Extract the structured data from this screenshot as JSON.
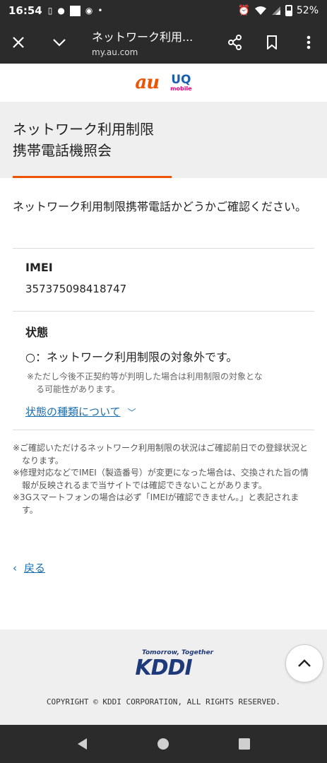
{
  "status_bar": {
    "time": "16:54",
    "battery": "52%",
    "icons": [
      "sim-icon",
      "line-icon",
      "image-icon",
      "chrome-icon",
      "dot-icon",
      "alarm-icon",
      "wifi-icon",
      "signal-icon",
      "battery-icon"
    ]
  },
  "browser": {
    "title": "ネットワーク利用...",
    "url": "my.au.com",
    "icons": [
      "close-icon",
      "chevron-down-icon",
      "share-icon",
      "bookmark-icon",
      "more-icon"
    ]
  },
  "logos": {
    "au": "au",
    "uq": "UQ",
    "uq_sub": "mobile"
  },
  "page": {
    "title_line1": "ネットワーク利用制限",
    "title_line2": "携帯電話機照会",
    "intro": "ネットワーク利用制限携帯電話かどうかご確認ください。"
  },
  "imei": {
    "label": "IMEI",
    "value": "357375098418747"
  },
  "state": {
    "label": "状態",
    "value": "○：ネットワーク利用制限の対象外です。",
    "note_line1": "※ただし今後不正契約等が判明した場合は利用制限の対象とな",
    "note_line2": "る可能性があります。",
    "link": "状態の種類について"
  },
  "notes": [
    "※ご確認いただけるネットワーク利用制限の状況はご確認前日での登録状況となります。",
    "※修理対応などでIMEI（製造番号）が変更になった場合は、交換された旨の情報が反映されるまで当サイトでは確認できないことがあります。",
    "※3Gスマートフォンの場合は必ず「IMEIが確認できません。」と表記されます。"
  ],
  "back": {
    "label": "戻る"
  },
  "footer": {
    "tagline": "Tomorrow, Together",
    "brand": "KDDI",
    "copyright": "COPYRIGHT © KDDI CORPORATION, ALL RIGHTS RESERVED."
  },
  "colors": {
    "accent": "#eb5505",
    "link": "#1a6fb0",
    "dark_bar": "#2b2b2b",
    "kddi_blue": "#1f3a7a"
  }
}
